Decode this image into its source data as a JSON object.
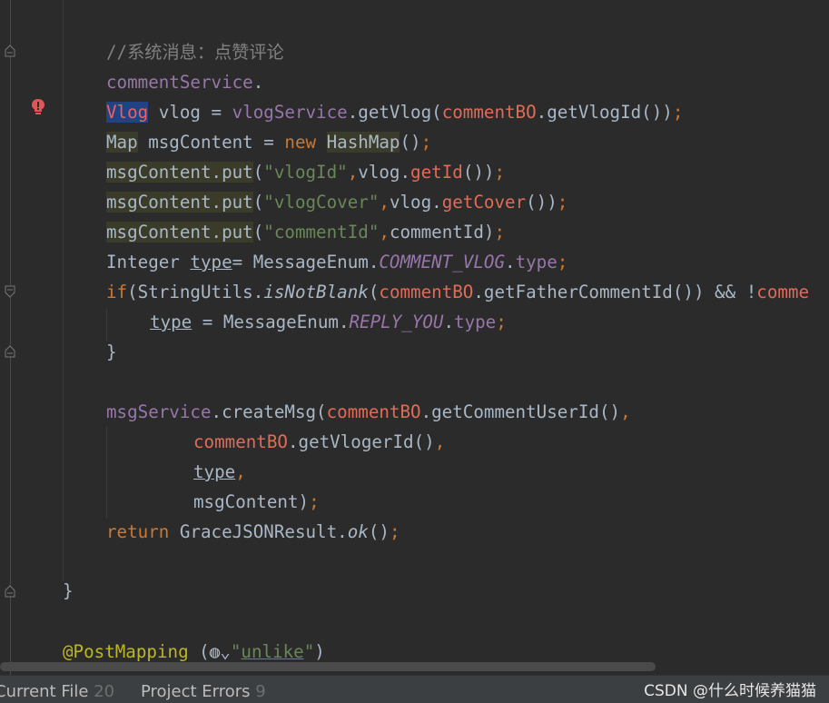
{
  "editor": {
    "lines": [
      {
        "tokens": [
          {
            "t": "//系统消息：点赞评论",
            "c": "tok-comment"
          }
        ]
      },
      {
        "tokens": [
          {
            "t": "commentService",
            "c": "tok-field"
          },
          {
            "t": ".",
            "c": "tok-plain"
          }
        ]
      },
      {
        "tokens": [
          {
            "t": "Vlog",
            "c": "tok-err sel-bg"
          },
          {
            "t": " vlog = ",
            "c": "tok-plain"
          },
          {
            "t": "vlogService",
            "c": "tok-field"
          },
          {
            "t": ".getVlog(",
            "c": "tok-plain"
          },
          {
            "t": "commentBO",
            "c": "tok-red"
          },
          {
            "t": ".getVlogId())",
            "c": "tok-plain"
          },
          {
            "t": ";",
            "c": "tok-kw"
          }
        ]
      },
      {
        "tokens": [
          {
            "t": "Map",
            "c": "tok-plain hl-bg"
          },
          {
            "t": " msgContent = ",
            "c": "tok-plain"
          },
          {
            "t": "new ",
            "c": "tok-kw"
          },
          {
            "t": "HashMap",
            "c": "tok-plain hl-bg"
          },
          {
            "t": "()",
            "c": "tok-plain"
          },
          {
            "t": ";",
            "c": "tok-kw"
          }
        ]
      },
      {
        "tokens": [
          {
            "t": "msgContent.put",
            "c": "tok-plain hl-bg"
          },
          {
            "t": "(",
            "c": "tok-plain"
          },
          {
            "t": "\"vlogId\"",
            "c": "tok-str"
          },
          {
            "t": ",",
            "c": "tok-kw"
          },
          {
            "t": "vlog.",
            "c": "tok-plain"
          },
          {
            "t": "getId",
            "c": "tok-red"
          },
          {
            "t": "())",
            "c": "tok-plain"
          },
          {
            "t": ";",
            "c": "tok-kw"
          }
        ]
      },
      {
        "tokens": [
          {
            "t": "msgContent.put",
            "c": "tok-plain hl-bg"
          },
          {
            "t": "(",
            "c": "tok-plain"
          },
          {
            "t": "\"vlogCover\"",
            "c": "tok-str"
          },
          {
            "t": ",",
            "c": "tok-kw"
          },
          {
            "t": "vlog.",
            "c": "tok-plain"
          },
          {
            "t": "getCover",
            "c": "tok-red"
          },
          {
            "t": "())",
            "c": "tok-plain"
          },
          {
            "t": ";",
            "c": "tok-kw"
          }
        ]
      },
      {
        "tokens": [
          {
            "t": "msgContent.put",
            "c": "tok-plain hl-bg"
          },
          {
            "t": "(",
            "c": "tok-plain"
          },
          {
            "t": "\"commentId\"",
            "c": "tok-str"
          },
          {
            "t": ",",
            "c": "tok-kw"
          },
          {
            "t": "commentId)",
            "c": "tok-plain"
          },
          {
            "t": ";",
            "c": "tok-kw"
          }
        ]
      },
      {
        "tokens": [
          {
            "t": "Integer ",
            "c": "tok-plain"
          },
          {
            "t": "type",
            "c": "tok-plain tok-under"
          },
          {
            "t": "= MessageEnum.",
            "c": "tok-plain"
          },
          {
            "t": "COMMENT_VLOG",
            "c": "tok-italic"
          },
          {
            "t": ".",
            "c": "tok-plain"
          },
          {
            "t": "type",
            "c": "tok-field"
          },
          {
            "t": ";",
            "c": "tok-kw"
          }
        ]
      },
      {
        "tokens": [
          {
            "t": "if",
            "c": "tok-kw"
          },
          {
            "t": "(StringUtils.",
            "c": "tok-plain"
          },
          {
            "t": "isNotBlank",
            "c": "tok-italic-plain"
          },
          {
            "t": "(",
            "c": "tok-plain"
          },
          {
            "t": "commentBO",
            "c": "tok-red"
          },
          {
            "t": ".getFatherCommentId()) && !",
            "c": "tok-plain"
          },
          {
            "t": "comme",
            "c": "tok-red"
          }
        ]
      },
      {
        "tokens": [
          {
            "t": "type",
            "c": "tok-plain tok-under"
          },
          {
            "t": " = MessageEnum.",
            "c": "tok-plain"
          },
          {
            "t": "REPLY_YOU",
            "c": "tok-italic"
          },
          {
            "t": ".",
            "c": "tok-plain"
          },
          {
            "t": "type",
            "c": "tok-field"
          },
          {
            "t": ";",
            "c": "tok-kw"
          }
        ]
      },
      {
        "tokens": [
          {
            "t": "}",
            "c": "tok-plain"
          }
        ]
      },
      {
        "tokens": [
          {
            "t": "msgService",
            "c": "tok-field"
          },
          {
            "t": ".createMsg(",
            "c": "tok-plain"
          },
          {
            "t": "commentBO",
            "c": "tok-red"
          },
          {
            "t": ".getCommentUserId()",
            "c": "tok-plain"
          },
          {
            "t": ",",
            "c": "tok-kw"
          }
        ]
      },
      {
        "tokens": [
          {
            "t": "commentBO",
            "c": "tok-red"
          },
          {
            "t": ".getVlogerId()",
            "c": "tok-plain"
          },
          {
            "t": ",",
            "c": "tok-kw"
          }
        ]
      },
      {
        "tokens": [
          {
            "t": "type",
            "c": "tok-plain tok-under"
          },
          {
            "t": ",",
            "c": "tok-kw"
          }
        ]
      },
      {
        "tokens": [
          {
            "t": "msgContent)",
            "c": "tok-plain"
          },
          {
            "t": ";",
            "c": "tok-kw"
          }
        ]
      },
      {
        "tokens": [
          {
            "t": "return ",
            "c": "tok-kw"
          },
          {
            "t": "GraceJSONResult.",
            "c": "tok-plain"
          },
          {
            "t": "ok",
            "c": "tok-italic-plain"
          },
          {
            "t": "()",
            "c": "tok-plain"
          },
          {
            "t": ";",
            "c": "tok-kw"
          }
        ]
      },
      {
        "tokens": [
          {
            "t": "}",
            "c": "tok-plain"
          }
        ]
      },
      {
        "tokens": [
          {
            "t": "@PostMapping",
            "c": "tok-ann"
          },
          {
            "t": " (",
            "c": "tok-plain"
          },
          {
            "t": "◍⌄",
            "c": "tok-plain"
          },
          {
            "t": "\"",
            "c": "tok-str"
          },
          {
            "t": "unlike",
            "c": "tok-str tok-under"
          },
          {
            "t": "\"",
            "c": "tok-str"
          },
          {
            "t": ")",
            "c": "tok-plain"
          }
        ]
      }
    ]
  },
  "icons": {
    "error": "error-bulb-icon",
    "fold": "fold-marker-icon",
    "globe": "globe-icon"
  },
  "statusbar": {
    "tab1_label": "Current File",
    "tab1_count": "20",
    "tab2_label": "Project Errors",
    "tab2_count": "9"
  },
  "watermark": "CSDN @什么时候养猫猫",
  "colors": {
    "background": "#2b2b2b",
    "keyword": "#cc7832",
    "string": "#6a8759",
    "field": "#9876aa",
    "error_ref": "#e06c58",
    "annotation": "#bbb529",
    "comment": "#808080"
  }
}
